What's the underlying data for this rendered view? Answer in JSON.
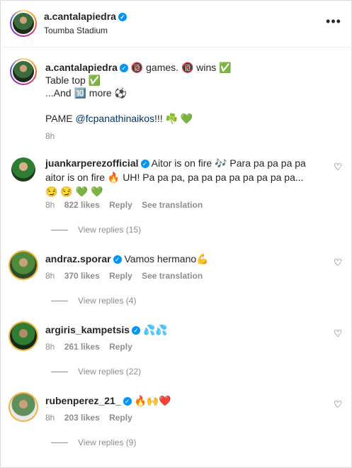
{
  "post": {
    "username": "a.cantalapiedra",
    "location": "Toumba Stadium",
    "more_label": "•••"
  },
  "caption": {
    "username": "a.cantalapiedra",
    "line1": "🔞 games. 🔞 wins ✅",
    "line2": "Table top ✅",
    "line3": "...And 🔟 more ⚽",
    "line4_prefix": "PAME ",
    "line4_mention": "@fcpanathinaikos",
    "line4_suffix": "!!! ☘️ 💚",
    "time": "8h"
  },
  "comments": [
    {
      "username": "juankarperezofficial",
      "text": "Aitor is on fire 🎶 Para pa pa pa pa aitor is on fire 🔥 UH! Pa pa pa, pa pa pa pa pa pa pa pa... 😏 😏 💚 💚",
      "time": "8h",
      "likes": "822 likes",
      "reply": "Reply",
      "translate": "See translation",
      "view_replies": "View replies (15)"
    },
    {
      "username": "andraz.sporar",
      "text": "Vamos hermano💪",
      "time": "8h",
      "likes": "370 likes",
      "reply": "Reply",
      "translate": "See translation",
      "view_replies": "View replies (4)"
    },
    {
      "username": "argiris_kampetsis",
      "text": "💦💦",
      "time": "8h",
      "likes": "261 likes",
      "reply": "Reply",
      "view_replies": "View replies (22)"
    },
    {
      "username": "rubenperez_21_",
      "text": "🔥🙌❤️",
      "time": "8h",
      "likes": "203 likes",
      "reply": "Reply",
      "view_replies": "View replies (9)"
    }
  ],
  "colors": {
    "verified": "#0095f6",
    "mention": "#00376b",
    "muted": "#8e8e8e"
  },
  "icons": {
    "more": "more-options-icon",
    "verified": "verified-badge-icon",
    "like": "heart-outline-icon"
  }
}
